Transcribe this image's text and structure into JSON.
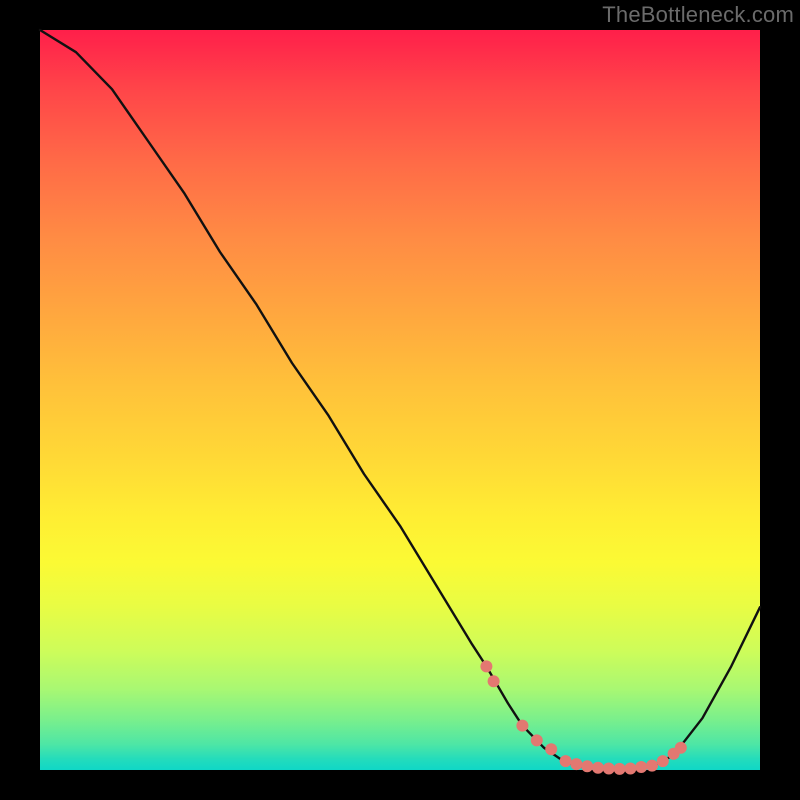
{
  "watermark": "TheBottleneck.com",
  "chart_data": {
    "type": "line",
    "title": "",
    "xlabel": "",
    "ylabel": "",
    "xlim": [
      0,
      100
    ],
    "ylim": [
      0,
      100
    ],
    "series": [
      {
        "name": "bottleneck-curve",
        "x": [
          0,
          5,
          10,
          15,
          20,
          25,
          30,
          35,
          40,
          45,
          50,
          55,
          60,
          62,
          65,
          67,
          70,
          73,
          75,
          78,
          80,
          82,
          85,
          88,
          92,
          96,
          100
        ],
        "y": [
          100,
          97,
          92,
          85,
          78,
          70,
          63,
          55,
          48,
          40,
          33,
          25,
          17,
          14,
          9,
          6,
          3,
          1,
          0.5,
          0.2,
          0.1,
          0.2,
          0.5,
          2,
          7,
          14,
          22
        ]
      }
    ],
    "markers": {
      "name": "highlight-dots",
      "style": "salmon-dot",
      "x": [
        62,
        63,
        67,
        69,
        71,
        73,
        74.5,
        76,
        77.5,
        79,
        80.5,
        82,
        83.5,
        85,
        86.5,
        88,
        89
      ],
      "y": [
        14,
        12,
        6,
        4,
        2.8,
        1.2,
        0.8,
        0.5,
        0.3,
        0.2,
        0.15,
        0.2,
        0.4,
        0.6,
        1.2,
        2.2,
        3
      ]
    },
    "grid": false,
    "legend": false
  }
}
